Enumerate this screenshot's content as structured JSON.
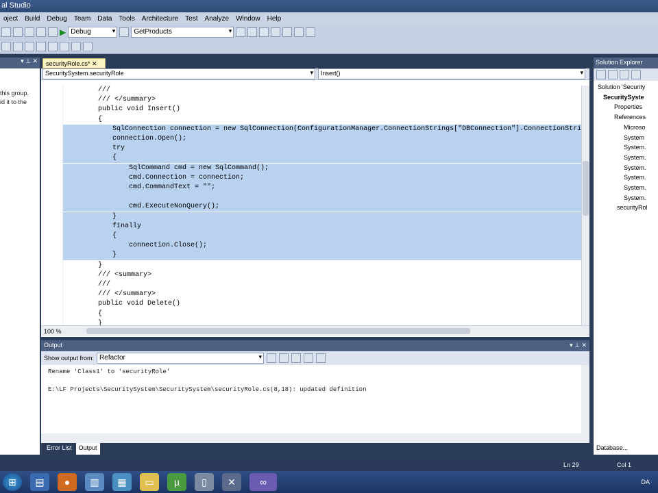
{
  "window": {
    "title": "al Studio"
  },
  "menu": [
    "oject",
    "Build",
    "Debug",
    "Team",
    "Data",
    "Tools",
    "Architecture",
    "Test",
    "Analyze",
    "Window",
    "Help"
  ],
  "toolbar": {
    "config": "Debug",
    "target": "GetProducts"
  },
  "left_panel": {
    "text_line1": "this group.",
    "text_line2": "id it to the"
  },
  "editor": {
    "tab_label": "securityRole.cs*",
    "class_combo": "SecuritySystem.securityRole",
    "member_combo": "Insert()",
    "zoom": "100 %",
    "lines": [
      {
        "text": "        ///",
        "sel": false
      },
      {
        "text": "        /// </summary>",
        "sel": false
      },
      {
        "text": "        public void Insert()",
        "sel": false
      },
      {
        "text": "        {",
        "sel": false
      },
      {
        "text": "            SqlConnection connection = new SqlConnection(ConfigurationManager.ConnectionStrings[\"DBConnection\"].ConnectionStri",
        "sel": true
      },
      {
        "text": "            connection.Open();",
        "sel": true
      },
      {
        "text": "            try",
        "sel": true
      },
      {
        "text": "            {",
        "sel": true
      },
      {
        "text": "                SqlCommand cmd = new SqlCommand();",
        "sel": true
      },
      {
        "text": "                cmd.Connection = connection;",
        "sel": true
      },
      {
        "text": "                cmd.CommandText = \"\";",
        "sel": true
      },
      {
        "text": "",
        "sel": true
      },
      {
        "text": "                cmd.ExecuteNonQuery();",
        "sel": true
      },
      {
        "text": "            }",
        "sel": true
      },
      {
        "text": "            finally",
        "sel": true
      },
      {
        "text": "            {",
        "sel": true
      },
      {
        "text": "                connection.Close();",
        "sel": true
      },
      {
        "text": "            }",
        "sel": true
      },
      {
        "text": "        }",
        "sel": false
      },
      {
        "text": "        /// <summary>",
        "sel": false
      },
      {
        "text": "        ///",
        "sel": false
      },
      {
        "text": "        /// </summary>",
        "sel": false
      },
      {
        "text": "        public void Delete()",
        "sel": false
      },
      {
        "text": "        {",
        "sel": false
      },
      {
        "text": "        }",
        "sel": false
      }
    ]
  },
  "output": {
    "title": "Output",
    "show_from_label": "Show output from:",
    "source": "Refactor",
    "line1": "Rename 'Class1' to 'securityRole'",
    "line2": "E:\\LF Projects\\SecuritySystem\\SecuritySystem\\securityRole.cs(8,18): updated definition",
    "tab_error": "Error List",
    "tab_output": "Output"
  },
  "solution_explorer": {
    "title": "Solution Explorer",
    "items": [
      "Solution 'Security",
      "SecuritySyste",
      "Properties",
      "References",
      "Microso",
      "System",
      "System.",
      "System.",
      "System.",
      "System.",
      "System.",
      "System.",
      "securityRol"
    ],
    "bottom_tab": "Database..."
  },
  "status": {
    "line": "Ln 29",
    "col": "Col 1"
  },
  "taskbar": {
    "lang": "DA"
  }
}
